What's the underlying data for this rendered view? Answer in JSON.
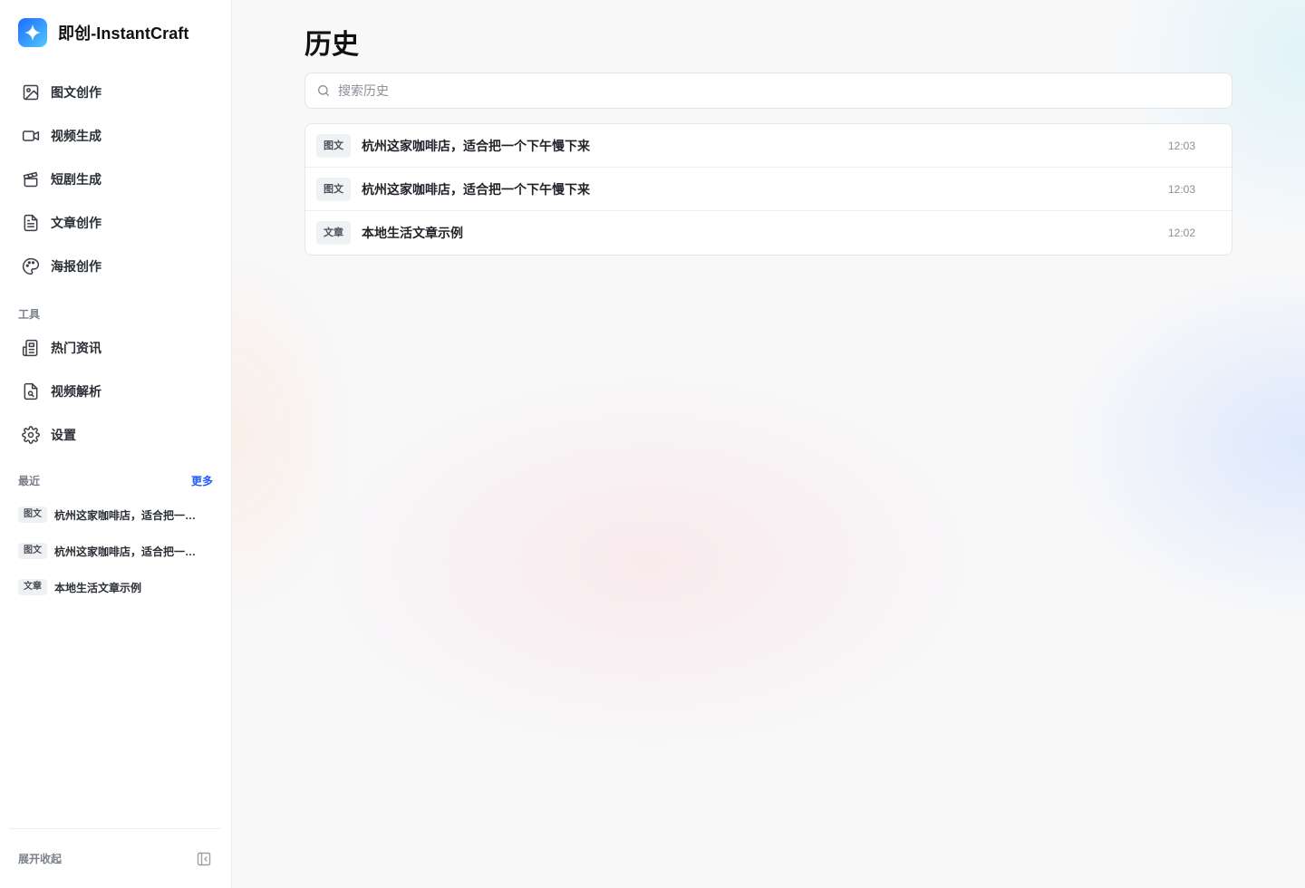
{
  "brand": {
    "title": "即创-InstantCraft"
  },
  "nav": {
    "items": [
      {
        "label": "图文创作",
        "icon": "image-icon"
      },
      {
        "label": "视频生成",
        "icon": "video-camera-icon"
      },
      {
        "label": "短剧生成",
        "icon": "clapperboard-icon"
      },
      {
        "label": "文章创作",
        "icon": "document-icon"
      },
      {
        "label": "海报创作",
        "icon": "palette-icon"
      }
    ],
    "tools_title": "工具",
    "tools": [
      {
        "label": "热门资讯",
        "icon": "newspaper-icon"
      },
      {
        "label": "视频解析",
        "icon": "file-search-icon"
      },
      {
        "label": "设置",
        "icon": "gear-icon"
      }
    ]
  },
  "recent": {
    "title": "最近",
    "more": "更多",
    "items": [
      {
        "tag": "图文",
        "title": "杭州这家咖啡店，适合把一个下午慢下来"
      },
      {
        "tag": "图文",
        "title": "杭州这家咖啡店，适合把一个下午慢下来"
      },
      {
        "tag": "文章",
        "title": "本地生活文章示例"
      }
    ]
  },
  "footer": {
    "label": "展开收起",
    "icon": "sidebar-collapse-icon"
  },
  "main": {
    "title": "历史",
    "search": {
      "placeholder": "搜索历史",
      "value": ""
    },
    "history": [
      {
        "tag": "图文",
        "title": "杭州这家咖啡店，适合把一个下午慢下来",
        "time": "12:03"
      },
      {
        "tag": "图文",
        "title": "杭州这家咖啡店，适合把一个下午慢下来",
        "time": "12:03"
      },
      {
        "tag": "文章",
        "title": "本地生活文章示例",
        "time": "12:02"
      }
    ]
  },
  "colors": {
    "accent": "#1f5eff",
    "logo_gradient_start": "#1e6bff",
    "logo_gradient_end": "#5cc6ff"
  }
}
